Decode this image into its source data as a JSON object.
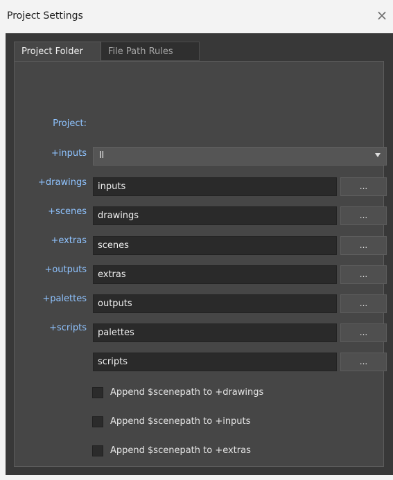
{
  "window": {
    "title": "Project Settings",
    "close_icon": "×"
  },
  "tabs": [
    {
      "label": "Project Folder",
      "active": true
    },
    {
      "label": "File Path Rules",
      "active": false
    }
  ],
  "project": {
    "label": "Project:",
    "value": "ll"
  },
  "rows": [
    {
      "label": "+inputs",
      "value": "inputs",
      "button": "..."
    },
    {
      "label": "+drawings",
      "value": "drawings",
      "button": "..."
    },
    {
      "label": "+scenes",
      "value": "scenes",
      "button": "..."
    },
    {
      "label": "+extras",
      "value": "extras",
      "button": "..."
    },
    {
      "label": "+outputs",
      "value": "outputs",
      "button": "..."
    },
    {
      "label": "+palettes",
      "value": "palettes",
      "button": "..."
    },
    {
      "label": "+scripts",
      "value": "scripts",
      "button": "..."
    }
  ],
  "checkboxes": [
    {
      "label": "Append $scenepath to +drawings",
      "checked": false
    },
    {
      "label": "Append $scenepath to +inputs",
      "checked": false
    },
    {
      "label": "Append $scenepath to +extras",
      "checked": false
    }
  ]
}
